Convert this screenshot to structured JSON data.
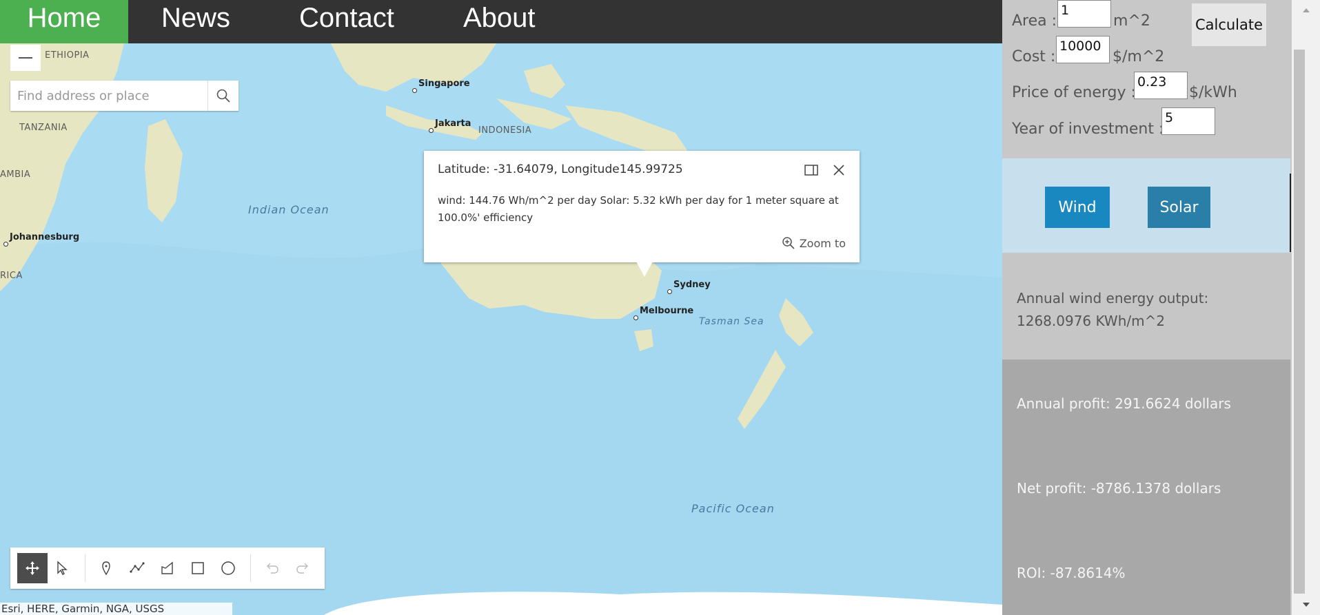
{
  "nav": {
    "items": [
      "Home",
      "News",
      "Contact",
      "About"
    ],
    "active": "Home"
  },
  "map": {
    "search_placeholder": "Find address or place",
    "labels": {
      "ethiopia": "ETHIOPIA",
      "tanzania": "TANZANIA",
      "zambia": "AMBIA",
      "rica": "RICA",
      "singapore": "Singapore",
      "jakarta": "Jakarta",
      "indonesia": "INDONESIA",
      "indian_ocean": "Indian Ocean",
      "johannesburg": "Johannesburg",
      "sydney": "Sydney",
      "melbourne": "Melbourne",
      "tasman_sea": "Tasman Sea",
      "pacific_ocean": "Pacific Ocean"
    },
    "attribution": "Esri, HERE, Garmin, NGA, USGS"
  },
  "popup": {
    "title": "Latitude: -31.64079, Longitude145.99725",
    "body": "wind: 144.76 Wh/m^2 per day Solar: 5.32 kWh per day for 1 meter square at 100.0%' efficiency",
    "zoom_label": "Zoom to"
  },
  "toolbar": {
    "tools": [
      "move-icon",
      "select-icon",
      "point-icon",
      "polyline-icon",
      "polygon-icon",
      "rectangle-icon",
      "circle-icon",
      "undo-icon",
      "redo-icon"
    ]
  },
  "panel": {
    "area_label": "Area :",
    "area_value": "1",
    "area_unit": "m^2",
    "cost_label": "Cost :",
    "cost_value": "10000",
    "cost_unit": "$/m^2",
    "price_label": "Price of energy :",
    "price_value": "0.23",
    "price_unit": "$/kWh",
    "year_label": "Year of investment :",
    "year_value": "5",
    "calculate_label": "Calculate",
    "wind_label": "Wind",
    "solar_label": "Solar",
    "wind_output": "Annual wind energy output: 1268.0976 KWh/m^2",
    "annual_profit": "Annual profit: 291.6624 dollars",
    "net_profit": "Net profit: -8786.1378 dollars",
    "roi": "ROI: -87.8614%"
  },
  "colors": {
    "nav_bg": "#333333",
    "nav_active": "#4caf50",
    "wind_button": "#1a88c0",
    "solar_button": "#2a7fa8",
    "ocean": "#a9dbf3",
    "land": "#e7e6c3"
  }
}
